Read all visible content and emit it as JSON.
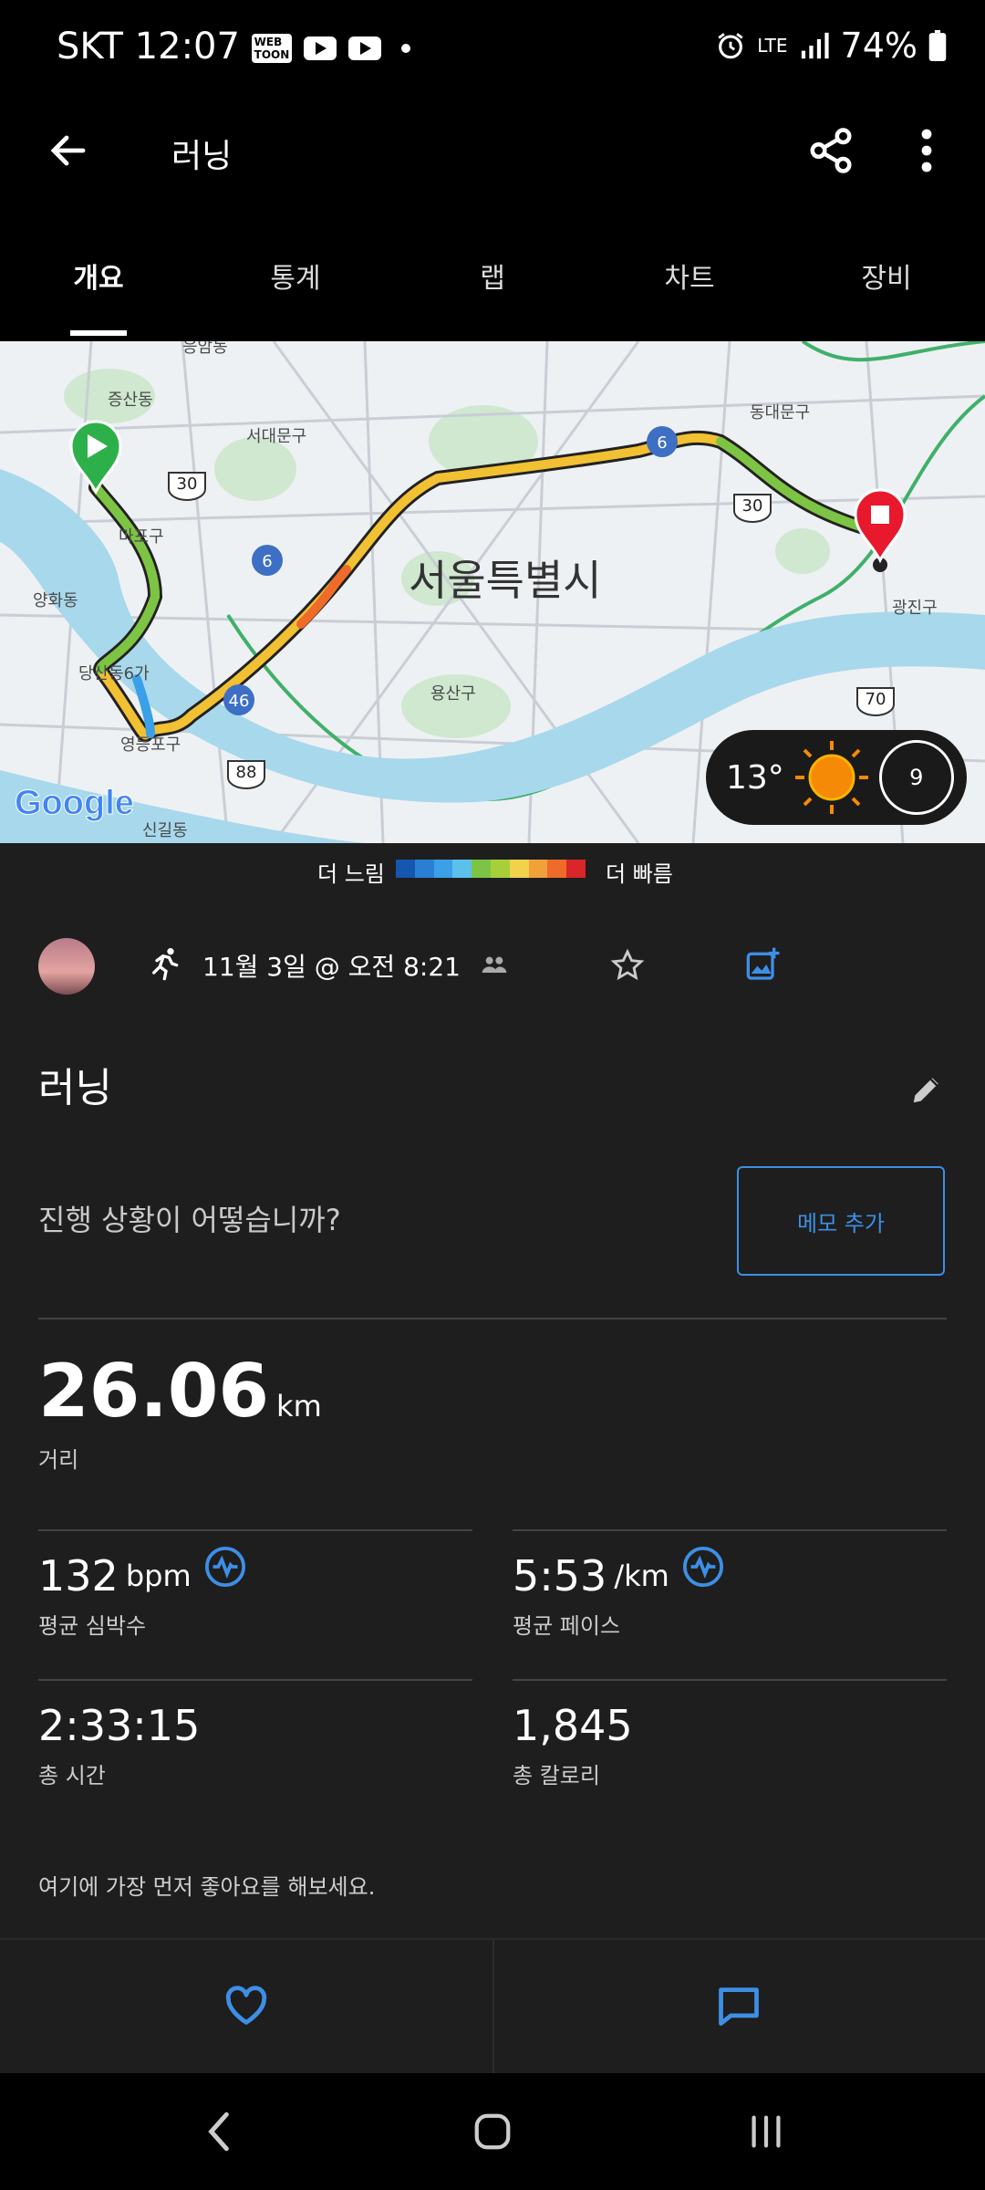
{
  "status": {
    "carrier": "SKT",
    "time": "12:07",
    "network": "LTE",
    "battery": "74%",
    "icons": [
      "webtoon-icon",
      "youtube-icon",
      "youtube-icon",
      "dot-icon",
      "alarm-icon",
      "signal-icon",
      "battery-icon"
    ]
  },
  "header": {
    "title": "러닝",
    "back_icon": "arrow-left-icon",
    "share_icon": "share-icon",
    "more_icon": "more-vertical-icon"
  },
  "tabs": [
    {
      "label": "개요",
      "active": true
    },
    {
      "label": "통계",
      "active": false
    },
    {
      "label": "랩",
      "active": false
    },
    {
      "label": "차트",
      "active": false
    },
    {
      "label": "장비",
      "active": false
    }
  ],
  "map": {
    "city_label": "서울특별시",
    "district_labels": [
      "증산동",
      "서대문구",
      "마포구",
      "양화동",
      "당산동6가",
      "영등포구",
      "용산구",
      "신길동",
      "동대문구",
      "광진구",
      "응암동"
    ],
    "road_shields": [
      "30",
      "6",
      "46",
      "88",
      "6",
      "30",
      "70"
    ],
    "google_logo": "Google",
    "weather": {
      "temp": "13°",
      "icon": "sun-icon",
      "uv": "9"
    }
  },
  "legend": {
    "slow": "더 느림",
    "fast": "더 빠름",
    "colors": [
      "#1556b0",
      "#2a7fd4",
      "#3aa0e8",
      "#5bc0eb",
      "#7cc444",
      "#a6cf3a",
      "#f2d24c",
      "#f2a13a",
      "#ee6b2a",
      "#d9262a"
    ]
  },
  "activity": {
    "date": "11월 3일 @ 오전 8:21",
    "name": "러닝",
    "prompt": "진행 상황이 어떻습니까?",
    "memo_button": "메모 추가"
  },
  "stats": {
    "distance": {
      "value": "26.06",
      "unit": "km",
      "label": "거리"
    },
    "heart_rate": {
      "value": "132",
      "unit": "bpm",
      "label": "평균 심박수"
    },
    "pace": {
      "value": "5:53",
      "unit": "/km",
      "label": "평균 페이스"
    },
    "time": {
      "value": "2:33:15",
      "label": "총 시간"
    },
    "calories": {
      "value": "1,845",
      "label": "총 칼로리"
    }
  },
  "like_prompt": "여기에 가장 먼저 좋아요를 해보세요.",
  "colors": {
    "accent": "#3d8fe6",
    "background": "#1e1e1e",
    "route_start": "#2db04a",
    "route_end": "#e8192c"
  }
}
